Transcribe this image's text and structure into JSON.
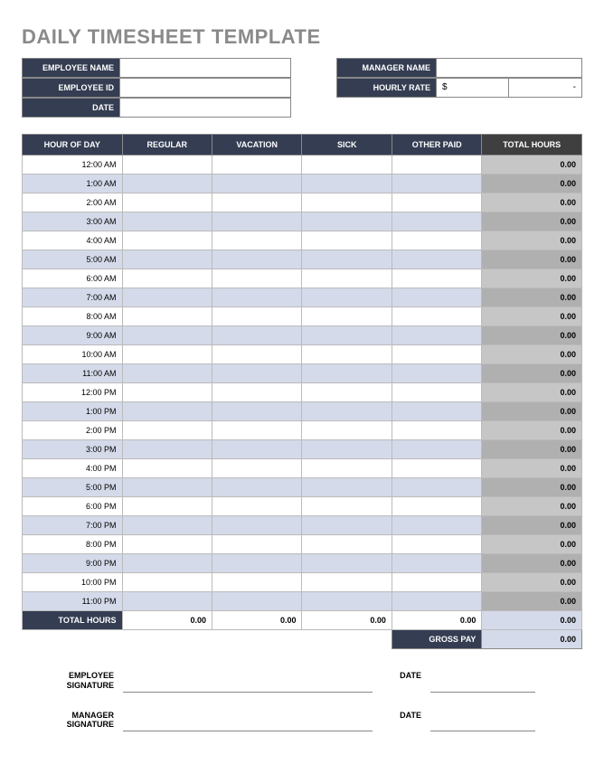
{
  "title": "DAILY TIMESHEET TEMPLATE",
  "info": {
    "employee_name_label": "EMPLOYEE NAME",
    "employee_name": "",
    "manager_name_label": "MANAGER NAME",
    "manager_name": "",
    "employee_id_label": "EMPLOYEE ID",
    "employee_id": "",
    "hourly_rate_label": "HOURLY RATE",
    "hourly_rate_currency": "$",
    "hourly_rate_value": "-",
    "date_label": "DATE",
    "date": ""
  },
  "columns": {
    "hour": "HOUR OF DAY",
    "regular": "REGULAR",
    "vacation": "VACATION",
    "sick": "SICK",
    "other": "OTHER PAID",
    "total": "TOTAL HOURS"
  },
  "rows": [
    {
      "hour": "12:00 AM",
      "regular": "",
      "vacation": "",
      "sick": "",
      "other": "",
      "total": "0.00"
    },
    {
      "hour": "1:00 AM",
      "regular": "",
      "vacation": "",
      "sick": "",
      "other": "",
      "total": "0.00"
    },
    {
      "hour": "2:00 AM",
      "regular": "",
      "vacation": "",
      "sick": "",
      "other": "",
      "total": "0.00"
    },
    {
      "hour": "3:00 AM",
      "regular": "",
      "vacation": "",
      "sick": "",
      "other": "",
      "total": "0.00"
    },
    {
      "hour": "4:00 AM",
      "regular": "",
      "vacation": "",
      "sick": "",
      "other": "",
      "total": "0.00"
    },
    {
      "hour": "5:00 AM",
      "regular": "",
      "vacation": "",
      "sick": "",
      "other": "",
      "total": "0.00"
    },
    {
      "hour": "6:00 AM",
      "regular": "",
      "vacation": "",
      "sick": "",
      "other": "",
      "total": "0.00"
    },
    {
      "hour": "7:00 AM",
      "regular": "",
      "vacation": "",
      "sick": "",
      "other": "",
      "total": "0.00"
    },
    {
      "hour": "8:00 AM",
      "regular": "",
      "vacation": "",
      "sick": "",
      "other": "",
      "total": "0.00"
    },
    {
      "hour": "9:00 AM",
      "regular": "",
      "vacation": "",
      "sick": "",
      "other": "",
      "total": "0.00"
    },
    {
      "hour": "10:00 AM",
      "regular": "",
      "vacation": "",
      "sick": "",
      "other": "",
      "total": "0.00"
    },
    {
      "hour": "11:00 AM",
      "regular": "",
      "vacation": "",
      "sick": "",
      "other": "",
      "total": "0.00"
    },
    {
      "hour": "12:00 PM",
      "regular": "",
      "vacation": "",
      "sick": "",
      "other": "",
      "total": "0.00"
    },
    {
      "hour": "1:00 PM",
      "regular": "",
      "vacation": "",
      "sick": "",
      "other": "",
      "total": "0.00"
    },
    {
      "hour": "2:00 PM",
      "regular": "",
      "vacation": "",
      "sick": "",
      "other": "",
      "total": "0.00"
    },
    {
      "hour": "3:00 PM",
      "regular": "",
      "vacation": "",
      "sick": "",
      "other": "",
      "total": "0.00"
    },
    {
      "hour": "4:00 PM",
      "regular": "",
      "vacation": "",
      "sick": "",
      "other": "",
      "total": "0.00"
    },
    {
      "hour": "5:00 PM",
      "regular": "",
      "vacation": "",
      "sick": "",
      "other": "",
      "total": "0.00"
    },
    {
      "hour": "6:00 PM",
      "regular": "",
      "vacation": "",
      "sick": "",
      "other": "",
      "total": "0.00"
    },
    {
      "hour": "7:00 PM",
      "regular": "",
      "vacation": "",
      "sick": "",
      "other": "",
      "total": "0.00"
    },
    {
      "hour": "8:00 PM",
      "regular": "",
      "vacation": "",
      "sick": "",
      "other": "",
      "total": "0.00"
    },
    {
      "hour": "9:00 PM",
      "regular": "",
      "vacation": "",
      "sick": "",
      "other": "",
      "total": "0.00"
    },
    {
      "hour": "10:00 PM",
      "regular": "",
      "vacation": "",
      "sick": "",
      "other": "",
      "total": "0.00"
    },
    {
      "hour": "11:00 PM",
      "regular": "",
      "vacation": "",
      "sick": "",
      "other": "",
      "total": "0.00"
    }
  ],
  "totals": {
    "label": "TOTAL HOURS",
    "regular": "0.00",
    "vacation": "0.00",
    "sick": "0.00",
    "other": "0.00",
    "total": "0.00"
  },
  "gross": {
    "label": "GROSS PAY",
    "value": "0.00"
  },
  "signatures": {
    "employee_label": "EMPLOYEE SIGNATURE",
    "manager_label": "MANAGER SIGNATURE",
    "date_label": "DATE"
  }
}
